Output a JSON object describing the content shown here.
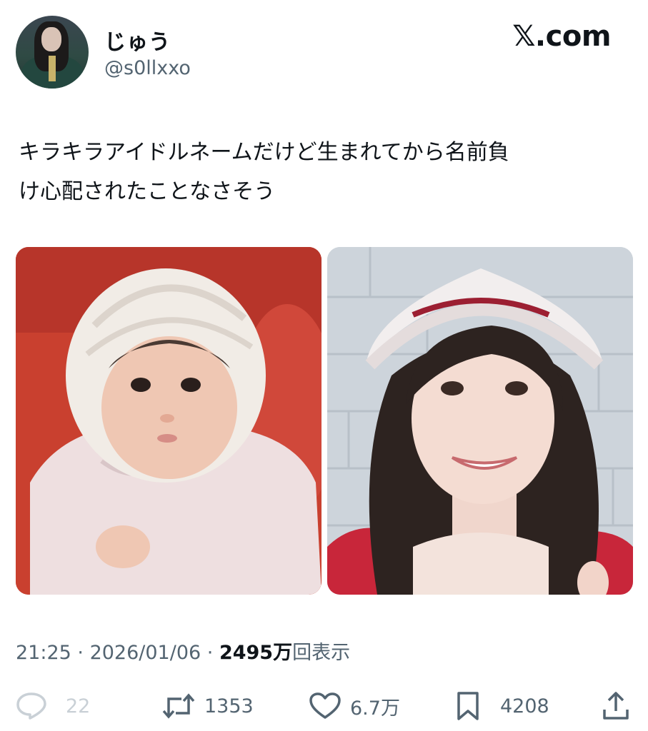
{
  "user": {
    "display_name": "じゅう",
    "handle": "@s0llxxo"
  },
  "site": {
    "logo_text": "𝕏.com"
  },
  "tweet": {
    "text_line1": "キラキラアイドルネームだけど生まれてから名前負",
    "text_line2": "け心配されたことなさそう"
  },
  "meta": {
    "time": "21:25",
    "separator": " · ",
    "date": "2026/01/06",
    "views_count": "2495万",
    "views_label": "回表示"
  },
  "actions": {
    "replies": "22",
    "reposts": "1353",
    "likes": "6.7万",
    "bookmarks": "4208"
  },
  "icons": {
    "reply": "reply-icon",
    "repost": "repost-icon",
    "like": "heart-icon",
    "bookmark": "bookmark-icon",
    "share": "share-icon"
  },
  "colors": {
    "text": "#0f1419",
    "secondary": "#536471",
    "muted": "#c9d0d6"
  }
}
